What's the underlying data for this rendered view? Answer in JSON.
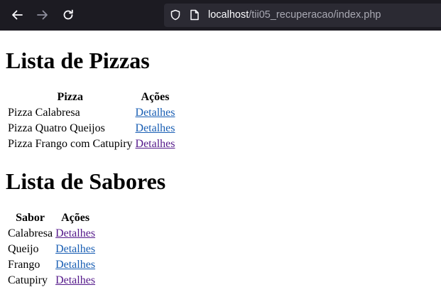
{
  "browser": {
    "url_host": "localhost",
    "url_path": "/tii05_recuperacao/index.php",
    "icons": [
      "back-icon",
      "forward-icon",
      "reload-icon",
      "shield-icon",
      "page-icon"
    ]
  },
  "pizzas": {
    "heading": "Lista de Pizzas",
    "headers": [
      "Pizza",
      "Ações"
    ],
    "rows": [
      {
        "name": "Pizza Calabresa",
        "link": "Detalhes"
      },
      {
        "name": "Pizza Quatro Queijos",
        "link": "Detalhes"
      },
      {
        "name": "Pizza Frango com Catupiry",
        "link": "Detalhes"
      }
    ]
  },
  "sabores": {
    "heading": "Lista de Sabores",
    "headers": [
      "Sabor",
      "Ações"
    ],
    "rows": [
      {
        "name": "Calabresa",
        "link": "Detalhes"
      },
      {
        "name": "Queijo",
        "link": "Detalhes"
      },
      {
        "name": "Frango",
        "link": "Detalhes"
      },
      {
        "name": "Catupiry",
        "link": "Detalhes"
      }
    ]
  },
  "colors": {
    "toolbar": "#1c1b22",
    "urlbar": "#2b2a33",
    "link": "#1a5fb4",
    "visited_link": "#551a8b"
  }
}
